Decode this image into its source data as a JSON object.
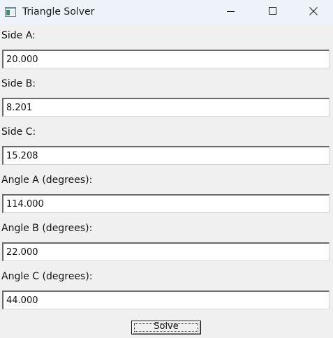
{
  "window": {
    "title": "Triangle Solver",
    "icon": "window-app-icon",
    "controls": [
      "minimize-icon",
      "maximize-icon",
      "close-icon"
    ]
  },
  "fields": {
    "side_a": {
      "label": "Side A:",
      "value": "20.000"
    },
    "side_b": {
      "label": "Side B:",
      "value": "8.201"
    },
    "side_c": {
      "label": "Side C:",
      "value": "15.208"
    },
    "angle_a": {
      "label": "Angle A (degrees):",
      "value": "114.000"
    },
    "angle_b": {
      "label": "Angle B (degrees):",
      "value": "22.000"
    },
    "angle_c": {
      "label": "Angle C (degrees):",
      "value": "44.000"
    }
  },
  "actions": {
    "solve_label": "Solve"
  },
  "colors": {
    "titlebar": "#eef3fa",
    "background": "#f0f0f0",
    "input_background": "#ffffff"
  }
}
